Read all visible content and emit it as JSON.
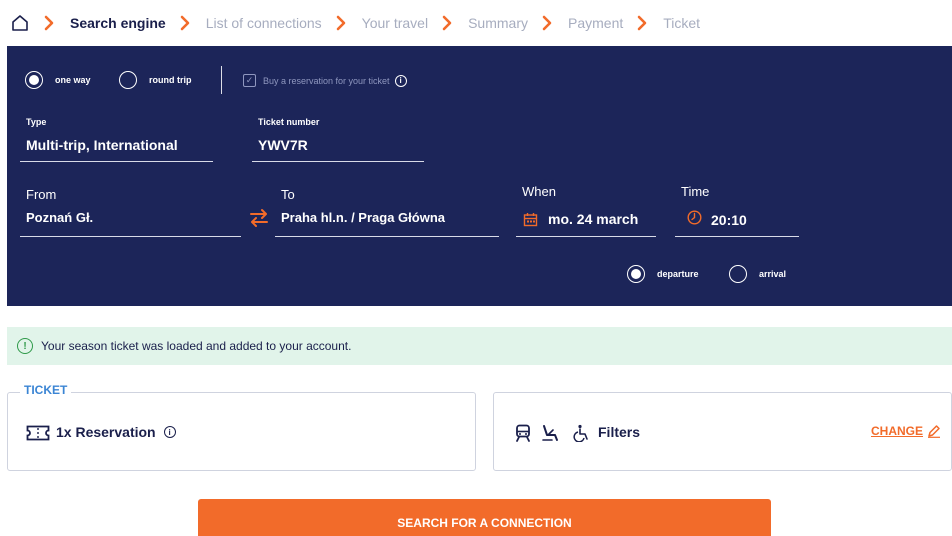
{
  "breadcrumb": {
    "items": [
      {
        "label": "Search engine",
        "active": true
      },
      {
        "label": "List of connections",
        "active": false
      },
      {
        "label": "Your travel",
        "active": false
      },
      {
        "label": "Summary",
        "active": false
      },
      {
        "label": "Payment",
        "active": false
      },
      {
        "label": "Ticket",
        "active": false
      }
    ]
  },
  "trip_mode": {
    "one_way": "one way",
    "round_trip": "round trip",
    "selected": "one way"
  },
  "reservation_checkbox": {
    "label": "Buy a reservation for your ticket",
    "checked": false
  },
  "ticket_type": {
    "label": "Type",
    "value": "Multi-trip, International"
  },
  "ticket_number": {
    "label": "Ticket number",
    "value": "YWV7R"
  },
  "from": {
    "label": "From",
    "value": "Poznań Gł."
  },
  "to": {
    "label": "To",
    "value": "Praha hl.n. / Praga Główna"
  },
  "when": {
    "label": "When",
    "value": "mo. 24 march"
  },
  "time": {
    "label": "Time",
    "value": "20:10"
  },
  "time_mode": {
    "departure": "departure",
    "arrival": "arrival",
    "selected": "departure"
  },
  "notice": {
    "text": "Your season ticket was loaded and added to your account."
  },
  "ticket_section": {
    "legend": "TICKET",
    "text": "1x Reservation"
  },
  "filters": {
    "label": "Filters",
    "change": "CHANGE"
  },
  "search_button": {
    "label": "SEARCH FOR A CONNECTION"
  },
  "colors": {
    "panel_bg": "#1c2559",
    "accent": "#f26b2a",
    "notice_bg": "#e1f4ea",
    "legend": "#3b85d4",
    "text_dark": "#1a1f4b",
    "text_muted": "#a7adbf"
  },
  "icons": {
    "home": "home-icon",
    "separator": "chevron-right-icon",
    "swap": "swap-arrows-icon",
    "date": "calendar-icon",
    "time": "clock-icon",
    "notice": "info-circle-icon",
    "ticket": "ticket-icon",
    "train": "train-icon",
    "seat": "reclining-seat-icon",
    "accessibility": "wheelchair-icon",
    "edit": "pencil-icon"
  }
}
